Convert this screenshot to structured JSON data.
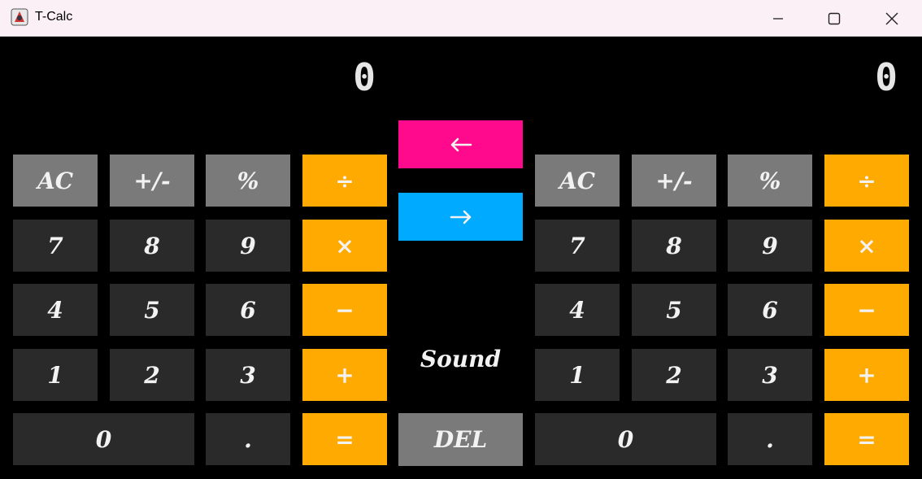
{
  "window": {
    "title": "T-Calc",
    "controls": {
      "minimize": "minimize-icon",
      "maximize": "maximize-icon",
      "close": "close-icon"
    }
  },
  "left_calc": {
    "display": "0",
    "rows": [
      [
        "AC",
        "+/-",
        "%",
        "÷"
      ],
      [
        "7",
        "8",
        "9",
        "×"
      ],
      [
        "4",
        "5",
        "6",
        "−"
      ],
      [
        "1",
        "2",
        "3",
        "+"
      ],
      [
        "0",
        ".",
        "="
      ]
    ]
  },
  "right_calc": {
    "display": "0",
    "rows": [
      [
        "AC",
        "+/-",
        "%",
        "÷"
      ],
      [
        "7",
        "8",
        "9",
        "×"
      ],
      [
        "4",
        "5",
        "6",
        "−"
      ],
      [
        "1",
        "2",
        "3",
        "+"
      ],
      [
        "0",
        ".",
        "="
      ]
    ]
  },
  "center": {
    "transfer_left": {
      "icon": "arrow-left-icon",
      "color": "#ff0a8c"
    },
    "transfer_right": {
      "icon": "arrow-right-icon",
      "color": "#00aaff"
    },
    "sound_label": "Sound",
    "del_label": "DEL"
  },
  "colors": {
    "gray": "#7a7a7a",
    "dark": "#2a2a2a",
    "orange": "#ffaa00",
    "background": "#000000"
  }
}
